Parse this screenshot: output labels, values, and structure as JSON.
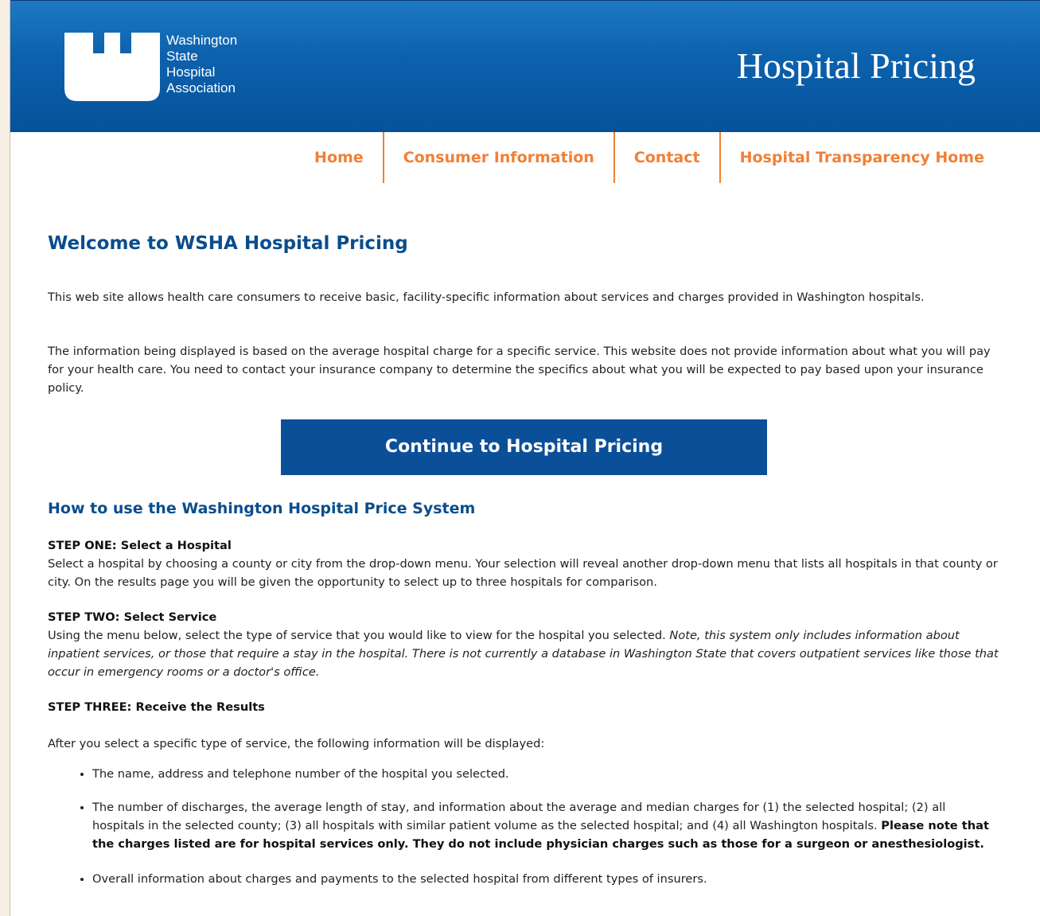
{
  "header": {
    "logo_lines": [
      "Washington",
      "State",
      "Hospital",
      "Association"
    ],
    "site_title": "Hospital Pricing"
  },
  "nav": {
    "items": [
      "Home",
      "Consumer Information",
      "Contact",
      "Hospital Transparency Home"
    ]
  },
  "colors": {
    "header_blue": "#0d62ae",
    "nav_orange": "#f08035",
    "heading_blue": "#0a4d8c",
    "button_blue": "#0c4f99"
  },
  "main": {
    "welcome_heading": "Welcome to WSHA Hospital Pricing",
    "intro_paragraphs": [
      "This web site allows health care consumers to receive basic, facility-specific information about services and charges provided in Washington hospitals.",
      "The information being displayed is based on the average hospital charge for a specific service. This website does not provide information about what you will pay for your health care. You need to contact your insurance company to determine the specifics about what you will be expected to pay based upon your insurance policy."
    ],
    "continue_label": "Continue to Hospital Pricing",
    "how_to_heading": "How to use the Washington Hospital Price System",
    "steps": {
      "one": {
        "title": "STEP ONE: Select a Hospital",
        "text": "Select a hospital by choosing a county or city from the drop-down menu. Your selection will reveal another drop-down menu that lists all hospitals in that county or city. On the results page you will be given the opportunity to select up to three hospitals for comparison."
      },
      "two": {
        "title": "STEP TWO: Select Service",
        "text": "Using the menu below, select the type of service that you would like to view for the hospital you selected. ",
        "note": "Note, this system only includes information about inpatient services, or those that require a stay in the hospital. There is not currently a database in Washington State that covers outpatient services like those that occur in emergency rooms or a doctor's office."
      },
      "three": {
        "title": "STEP THREE: Receive the Results"
      }
    },
    "after_text": "After you select a specific type of service, the following information will be displayed:",
    "results": {
      "item1": "The name, address and telephone number of the hospital you selected.",
      "item2_text": "The number of discharges, the average length of stay, and information about the average and median charges for (1) the selected hospital; (2) all hospitals in the selected county; (3) all hospitals with similar patient volume as the selected hospital; and (4) all Washington hospitals. ",
      "item2_bold": "Please note that the charges listed are for hospital services only. They do not include physician charges such as those for a surgeon or anesthesiologist.",
      "item3": "Overall information about charges and payments to the selected hospital from different types of insurers."
    }
  }
}
